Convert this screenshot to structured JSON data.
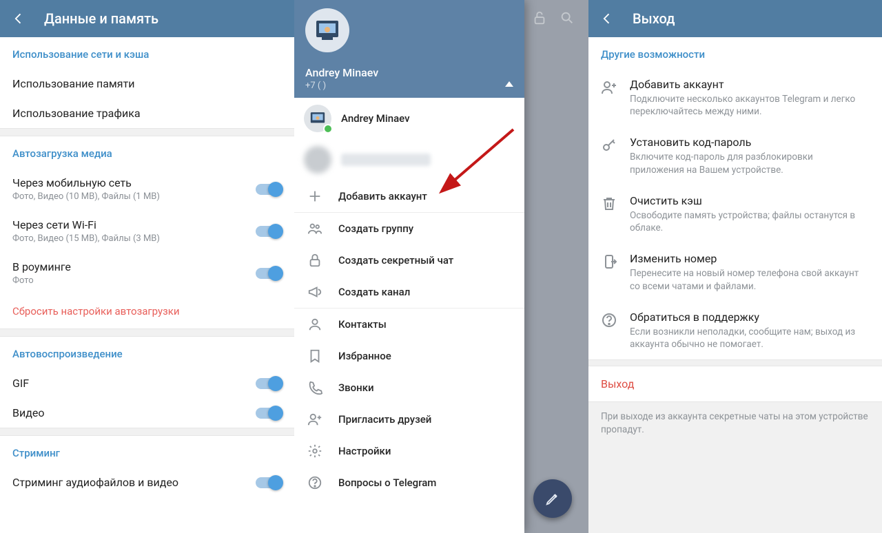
{
  "panel1": {
    "title": "Данные и память",
    "section_network": "Использование сети и кэша",
    "storage_usage": "Использование памяти",
    "traffic_usage": "Использование трафика",
    "section_autodl": "Автозагрузка медиа",
    "mobile": {
      "title": "Через мобильную сеть",
      "sub": "Фото, Видео (10 MB), Файлы (1 MB)"
    },
    "wifi": {
      "title": "Через сети Wi-Fi",
      "sub": "Фото, Видео (15 MB), Файлы (3 MB)"
    },
    "roaming": {
      "title": "В роуминге",
      "sub": "Фото"
    },
    "reset": "Сбросить настройки автозагрузки",
    "section_autoplay": "Автовоспроизведение",
    "gif": "GIF",
    "video": "Видео",
    "section_streaming": "Стриминг",
    "stream_audio_video": "Стриминг аудиофайлов и видео"
  },
  "panel2": {
    "user_name": "Andrey Minaev",
    "user_phone": "+7 (       )",
    "account_current": "Andrey Minaev",
    "add_account": "Добавить аккаунт",
    "create_group": "Создать группу",
    "secret_chat": "Создать секретный чат",
    "create_channel": "Создать канал",
    "contacts": "Контакты",
    "saved": "Избранное",
    "calls": "Звонки",
    "invite": "Пригласить друзей",
    "settings": "Настройки",
    "faq": "Вопросы о Telegram"
  },
  "panel3": {
    "title": "Выход",
    "section_other": "Другие возможности",
    "add_acc": {
      "t": "Добавить аккаунт",
      "s": "Подключите несколько аккаунтов Telegram и легко переключайтесь между ними."
    },
    "passcode": {
      "t": "Установить код-пароль",
      "s": "Включите код-пароль для разблокировки приложения на Вашем устройстве."
    },
    "clear_cache": {
      "t": "Очистить кэш",
      "s": "Освободите память устройства; файлы останутся в облаке."
    },
    "change_number": {
      "t": "Изменить номер",
      "s": "Перенесите на новый номер телефона свой аккаунт со всеми чатами и файлами."
    },
    "support": {
      "t": "Обратиться в поддержку",
      "s": "Если возникли неполадки, сообщите нам; выход из аккаунта обычно не помогает."
    },
    "logout_label": "Выход",
    "footer_note": "При выходе из аккаунта секретные чаты на этом устройстве пропадут."
  }
}
